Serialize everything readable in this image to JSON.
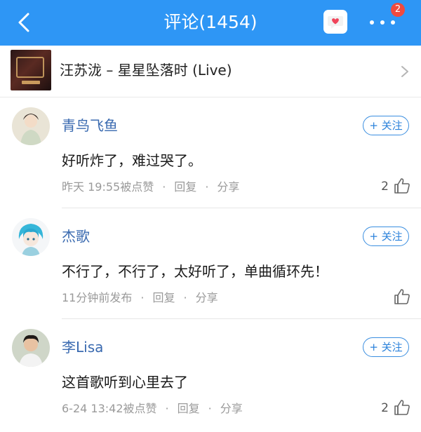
{
  "header": {
    "title": "评论(1454)",
    "badge_count": "2",
    "accent_color": "#2e96f5"
  },
  "song": {
    "title": "汪苏泷 – 星星坠落时 (Live)"
  },
  "comments": [
    {
      "username": "青鸟飞鱼",
      "follow_label": "+ 关注",
      "text": "好听炸了，难过哭了。",
      "time": "昨天 19:55被点赞",
      "reply_label": "回复",
      "share_label": "分享",
      "likes": "2"
    },
    {
      "username": "杰歌",
      "follow_label": "+ 关注",
      "text": "不行了，不行了，太好听了，单曲循环先！",
      "time": "11分钟前发布",
      "reply_label": "回复",
      "share_label": "分享",
      "likes": ""
    },
    {
      "username": "李Lisa",
      "follow_label": "+ 关注",
      "text": "这首歌听到心里去了",
      "time": "6-24 13:42被点赞",
      "reply_label": "回复",
      "share_label": "分享",
      "likes": "2"
    }
  ],
  "icons": {
    "back": "back-arrow-icon",
    "messages": "heart-message-icon",
    "more": "more-dots-icon",
    "like": "thumbs-up-icon"
  }
}
